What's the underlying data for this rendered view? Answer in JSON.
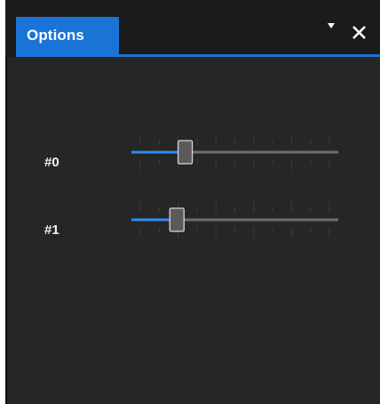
{
  "panel": {
    "tab_label": "Options",
    "menu_icon": "triangle-down-icon",
    "close_icon": "close-icon"
  },
  "sliders": [
    {
      "label": "#0",
      "value": 0.26
    },
    {
      "label": "#1",
      "value": 0.22
    }
  ],
  "colors": {
    "accent": "#1a74d8",
    "track_filled": "#2e8cf0",
    "track_empty": "#6e6e6e",
    "panel_bg": "#262626",
    "title_bg": "#1b1b1c"
  }
}
